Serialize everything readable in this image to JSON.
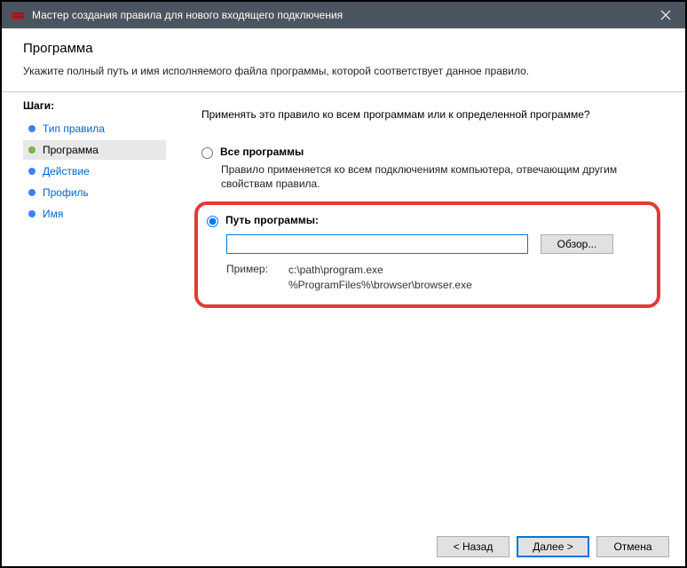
{
  "window": {
    "title": "Мастер создания правила для нового входящего подключения"
  },
  "header": {
    "title": "Программа",
    "description": "Укажите полный путь и имя исполняемого файла программы, которой соответствует данное правило."
  },
  "sidebar": {
    "title": "Шаги:",
    "steps": [
      {
        "label": "Тип правила",
        "link": true,
        "active": false
      },
      {
        "label": "Программа",
        "link": false,
        "active": true
      },
      {
        "label": "Действие",
        "link": true,
        "active": false
      },
      {
        "label": "Профиль",
        "link": true,
        "active": false
      },
      {
        "label": "Имя",
        "link": true,
        "active": false
      }
    ]
  },
  "main": {
    "question": "Применять это правило ко всем программам или к определенной программе?",
    "option_all": {
      "label": "Все программы",
      "description": "Правило применяется ко всем подключениям компьютера, отвечающим другим свойствам правила."
    },
    "option_path": {
      "label": "Путь программы:",
      "value": "",
      "browse": "Обзор...",
      "example_label": "Пример:",
      "example_line1": "c:\\path\\program.exe",
      "example_line2": "%ProgramFiles%\\browser\\browser.exe"
    }
  },
  "footer": {
    "back": "< Назад",
    "next": "Далее >",
    "cancel": "Отмена"
  }
}
